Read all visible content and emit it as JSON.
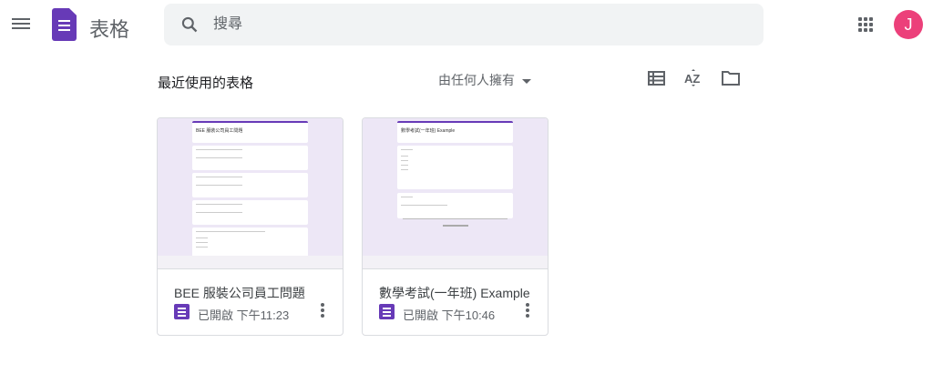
{
  "header": {
    "app_title": "表格",
    "search_placeholder": "搜尋",
    "avatar_letter": "J",
    "brand_color": "#673ab7",
    "avatar_color": "#ec407a"
  },
  "toolbar": {
    "section_title": "最近使用的表格",
    "owner_filter": "由任何人擁有",
    "icons": [
      "list-view-icon",
      "sort-az-icon",
      "folder-icon"
    ]
  },
  "cards": [
    {
      "title": "BEE 服裝公司員工問題",
      "meta": "已開啟 下午11:23"
    },
    {
      "title": "數學考試(一年班) Example",
      "meta": "已開啟 下午10:46"
    }
  ]
}
